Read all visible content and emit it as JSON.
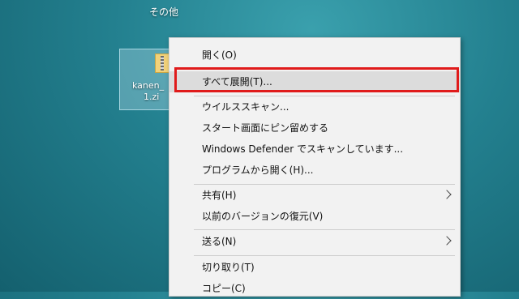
{
  "desktop": {
    "top_label": "その他",
    "file": {
      "name_line1": "kanen_",
      "name_line2": "1.zi",
      "icon": "zip-folder-icon"
    }
  },
  "context_menu": {
    "items": [
      {
        "label": "開く(O)"
      },
      {
        "label": "すべて展開(T)..."
      },
      {
        "label": "ウイルススキャン..."
      },
      {
        "label": "スタート画面にピン留めする"
      },
      {
        "label": "Windows Defender でスキャンしています..."
      },
      {
        "label": "プログラムから開く(H)..."
      },
      {
        "label": "共有(H)",
        "submenu": true
      },
      {
        "label": "以前のバージョンの復元(V)"
      },
      {
        "label": "送る(N)",
        "submenu": true
      },
      {
        "label": "切り取り(T)"
      },
      {
        "label": "コピー(C)"
      }
    ]
  },
  "annotation": {
    "color": "#e01b1b",
    "target": "すべて展開(T)..."
  }
}
